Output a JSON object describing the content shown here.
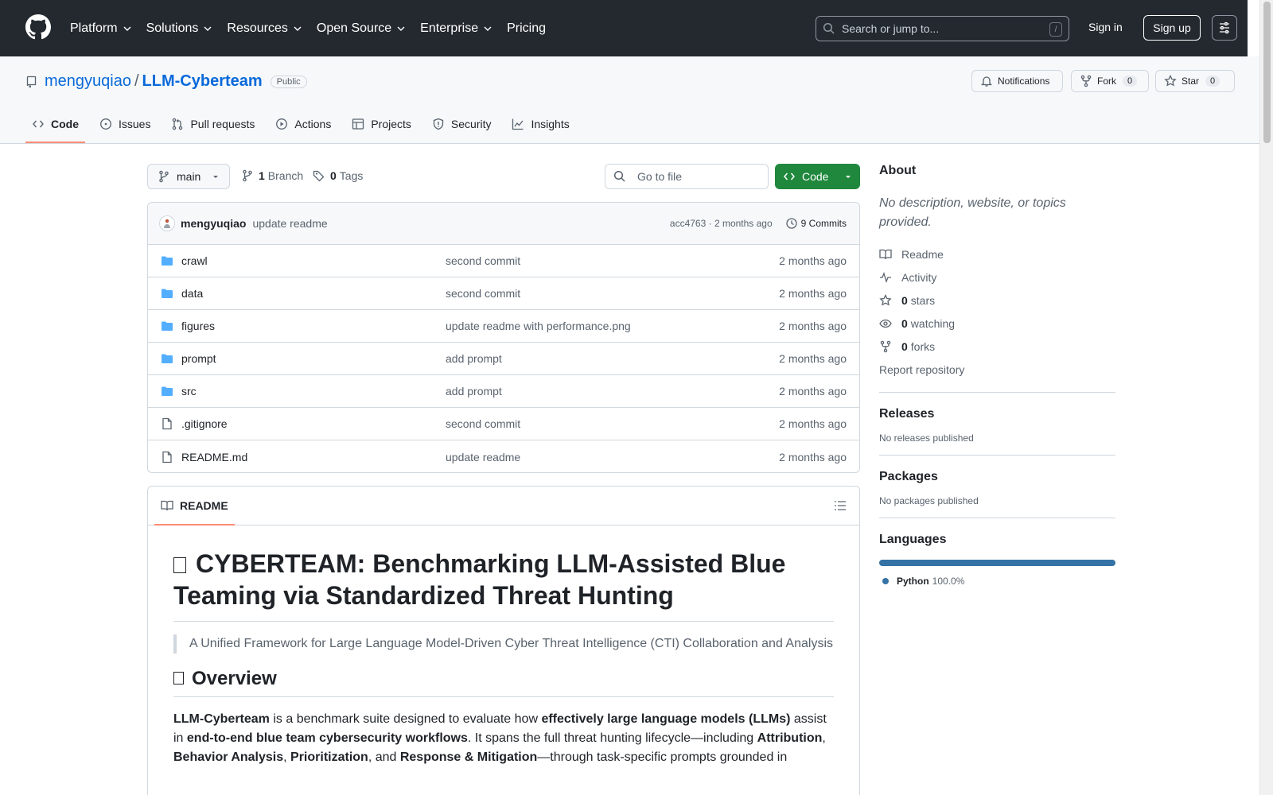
{
  "topnav": {
    "items": [
      {
        "label": "Platform",
        "chevron": true
      },
      {
        "label": "Solutions",
        "chevron": true
      },
      {
        "label": "Resources",
        "chevron": true
      },
      {
        "label": "Open Source",
        "chevron": true
      },
      {
        "label": "Enterprise",
        "chevron": true
      },
      {
        "label": "Pricing",
        "chevron": false
      }
    ],
    "search_placeholder": "Search or jump to...",
    "search_shortcut": "/",
    "signin": "Sign in",
    "signup": "Sign up"
  },
  "repo": {
    "owner": "mengyuqiao",
    "separator": "/",
    "name": "LLM-Cyberteam",
    "visibility": "Public",
    "notifications_label": "Notifications",
    "fork_label": "Fork",
    "fork_count": "0",
    "star_label": "Star",
    "star_count": "0"
  },
  "reponav": {
    "code": "Code",
    "issues": "Issues",
    "pulls": "Pull requests",
    "actions": "Actions",
    "projects": "Projects",
    "security": "Security",
    "insights": "Insights"
  },
  "toolbar": {
    "branch": "main",
    "branch_count": "1",
    "branch_label": "Branch",
    "tag_count": "0",
    "tag_label": "Tags",
    "goto_placeholder": "Go to file",
    "code_button": "Code"
  },
  "latest_commit": {
    "author": "mengyuqiao",
    "message": "update readme",
    "sha_time": "acc4763 · 2 months ago",
    "commits_label": "9 Commits"
  },
  "files": [
    {
      "name": "crawl",
      "type": "dir",
      "message": "second commit",
      "date": "2 months ago"
    },
    {
      "name": "data",
      "type": "dir",
      "message": "second commit",
      "date": "2 months ago"
    },
    {
      "name": "figures",
      "type": "dir",
      "message": "update readme with performance.png",
      "date": "2 months ago"
    },
    {
      "name": "prompt",
      "type": "dir",
      "message": "add prompt",
      "date": "2 months ago"
    },
    {
      "name": "src",
      "type": "dir",
      "message": "add prompt",
      "date": "2 months ago"
    },
    {
      "name": ".gitignore",
      "type": "file",
      "message": "second commit",
      "date": "2 months ago"
    },
    {
      "name": "README.md",
      "type": "file",
      "message": "update readme",
      "date": "2 months ago"
    }
  ],
  "readme": {
    "tab_label": "README",
    "title": "CYBERTEAM: Benchmarking LLM-Assisted Blue Teaming via Standardized Threat Hunting",
    "quote": "A Unified Framework for Large Language Model-Driven Cyber Threat Intelligence (CTI) Collaboration and Analysis",
    "overview_heading": "Overview",
    "p_bold1": "LLM-Cyberteam",
    "p_text1": " is a benchmark suite designed to evaluate how ",
    "p_bold2": "effectively large language models (LLMs)",
    "p_text2": " assist in ",
    "p_bold3": "end-to-end blue team cybersecurity workflows",
    "p_text3": ". It spans the full threat hunting lifecycle—including ",
    "p_bold4": "Attribution",
    "p_text4": ", ",
    "p_bold5": "Behavior Analysis",
    "p_text5": ", ",
    "p_bold6": "Prioritization",
    "p_text6": ", and ",
    "p_bold7": "Response & Mitigation",
    "p_text7": "—through task-specific prompts grounded in"
  },
  "sidebar": {
    "about_heading": "About",
    "description": "No description, website, or topics provided.",
    "readme_link": "Readme",
    "activity_link": "Activity",
    "stars_count": "0",
    "stars_label": "stars",
    "watching_count": "0",
    "watching_label": "watching",
    "forks_count": "0",
    "forks_label": "forks",
    "report_link": "Report repository",
    "releases_heading": "Releases",
    "releases_text": "No releases published",
    "packages_heading": "Packages",
    "packages_text": "No packages published",
    "languages_heading": "Languages",
    "languages": [
      {
        "name": "Python",
        "percent": "100.0%",
        "color": "#3572A5"
      }
    ]
  }
}
